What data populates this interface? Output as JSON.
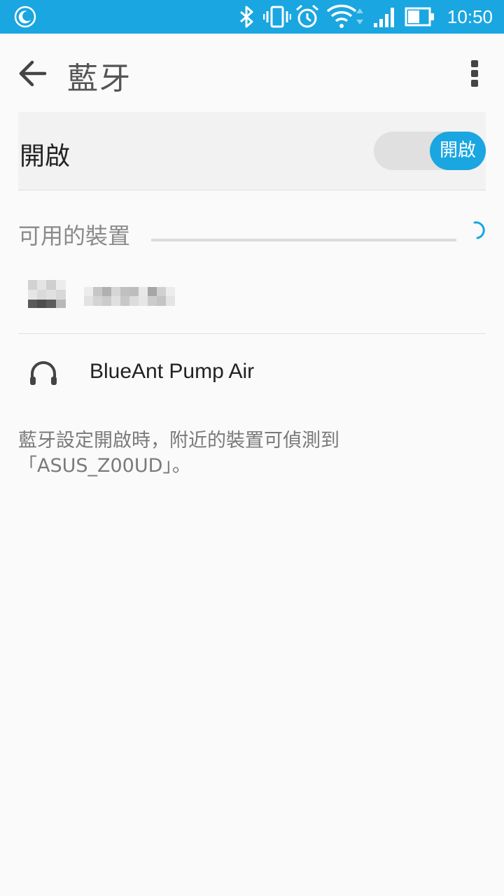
{
  "status_bar": {
    "time": "10:50",
    "icons": [
      "moon-icon",
      "bluetooth-icon",
      "vibrate-icon",
      "alarm-icon",
      "wifi-icon",
      "signal-icon",
      "battery-icon"
    ]
  },
  "app_bar": {
    "title": "藍牙",
    "back_icon": "arrow-left-icon",
    "menu_icon": "more-vert-icon"
  },
  "bluetooth_toggle": {
    "label": "開啟",
    "switch_text": "開啟",
    "state": "on"
  },
  "available_devices": {
    "header": "可用的裝置",
    "devices": [
      {
        "name": "BlueAnt Pump Air",
        "icon": "headphones-icon"
      }
    ]
  },
  "footer": {
    "line1": "藍牙設定開啟時，附近的裝置可偵測到",
    "line2": "「ASUS_Z00UD」。"
  },
  "colors": {
    "accent": "#1aa6e0",
    "background": "#fafafa"
  }
}
